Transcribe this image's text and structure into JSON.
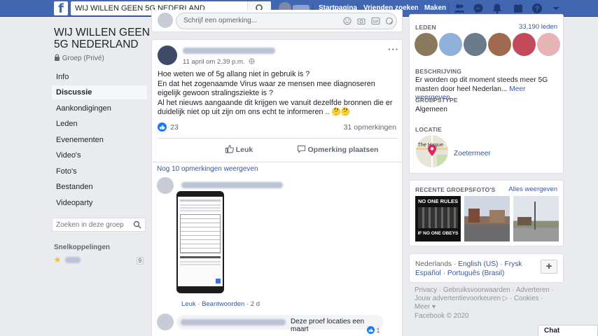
{
  "topbar": {
    "search_value": "WIJ WILLEN GEEN 5G NEDERLAND",
    "nav": [
      "Startpagina",
      "Vrienden zoeken",
      "Maken"
    ]
  },
  "group": {
    "title": "WIJ WILLEN GEEN 5G NEDERLAND",
    "type": "Groep (Privé)",
    "nav": [
      "Info",
      "Discussie",
      "Aankondigingen",
      "Leden",
      "Evenementen",
      "Video's",
      "Foto's",
      "Bestanden",
      "Videoparty"
    ],
    "active_nav": "Discussie",
    "search_placeholder": "Zoeken in deze groep",
    "shortcuts_label": "Snelkoppelingen",
    "shortcut_count": "9"
  },
  "composer": {
    "placeholder": "Schrijf een opmerking..."
  },
  "post": {
    "timestamp": "11 april om 2.39 p.m.",
    "body": [
      "Hoe weten we of 5g allang niet in gebruik is ?",
      "En dat het zogenaamde Virus waar ze mensen mee diagnoseren eigelijk gewoon stralingsziekte is ?",
      "Al het nieuws aangaande dit krijgen we vanuit dezelfde bronnen die er duidelijk niet op uit zijn om ons echt te informeren .. 🤔🤔"
    ],
    "reactions": "23",
    "comments_count": "31 opmerkingen",
    "like_label": "Leuk",
    "comment_label": "Opmerking plaatsen",
    "more_comments": "Nog 10 opmerkingen weergeven"
  },
  "comments": [
    {
      "actions": [
        "Leuk",
        "Beantwoorden",
        "2 d"
      ]
    },
    {
      "text": "Deze proef locaties een maart",
      "likes": "1"
    }
  ],
  "sidebar": {
    "members_label": "Leden",
    "members_count": "33,190 leden",
    "description_label": "Beschrijving",
    "description": "Er worden op dit moment steeds meer 5G masten door heel Nederlan...",
    "description_more": "Meer weergeven",
    "grouptype_label": "Groepstype",
    "grouptype": "Algemeen",
    "location_label": "Locatie",
    "location": "Zoetermeer",
    "map_label": "The Hague",
    "photos_label": "Recente groepsfoto's",
    "photos_more": "Alles weergeven",
    "photo1_text": [
      "NO ONE RULES",
      "IF NO ONE OBEYS"
    ]
  },
  "languages": {
    "current": "Nederlands",
    "others": [
      "English (US)",
      "Frysk",
      "Español",
      "Português (Brasil)"
    ]
  },
  "footer": {
    "links": "Privacy · Gebruiksvoorwaarden · Adverteren · Jouw advertentievoorkeuren ▷ · Cookies · Meer ▾",
    "copyright": "Facebook © 2020"
  },
  "chat": {
    "label": "Chat"
  },
  "colors": {
    "brand": "#4267b2",
    "link": "#385898",
    "background": "#e9ebee"
  }
}
